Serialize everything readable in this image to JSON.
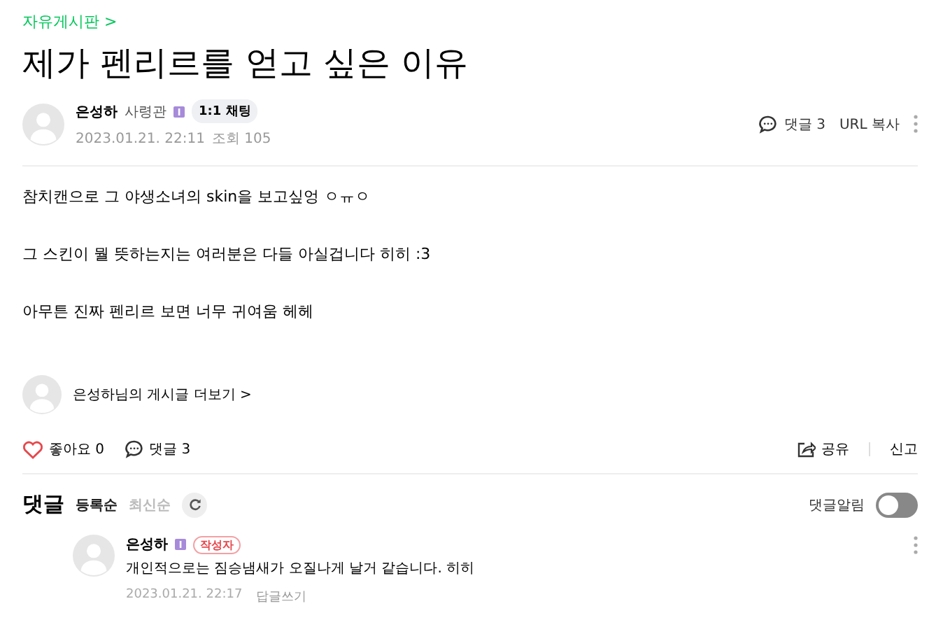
{
  "breadcrumb": "자유게시판 >",
  "post": {
    "title": "제가 펜리르를 얻고 싶은 이유",
    "author": "은성하",
    "rank": "사령관",
    "chat_button": "1:1 채팅",
    "date": "2023.01.21. 22:11",
    "views": "조회 105",
    "comment_link": "댓글 3",
    "url_copy": "URL 복사",
    "paragraphs": [
      "참치캔으로 그 야생소녀의 skin을 보고싶엉 ㅇㅠㅇ",
      "그 스킨이 뭘 뜻하는지는 여러분은 다들 아실겁니다 히히 :3",
      "아무튼 진짜 펜리르 보면 너무 귀여움 헤헤"
    ],
    "more_posts": "은성하님의 게시글 더보기 >"
  },
  "actions": {
    "like": "좋아요 0",
    "liked": false,
    "comments": "댓글 3",
    "share": "공유",
    "report": "신고"
  },
  "comments_section": {
    "heading": "댓글",
    "sorts": [
      {
        "label": "등록순",
        "selected": true
      },
      {
        "label": "최신순",
        "selected": false
      }
    ],
    "notify_label": "댓글알림",
    "notify_on": false,
    "comments": [
      {
        "author": "은성하",
        "badge": "작성자",
        "text": "개인적으로는 짐승냄새가 오질나게 날거 같습니다. 히히",
        "date": "2023.01.21. 22:17",
        "reply": "답글쓰기"
      }
    ]
  }
}
